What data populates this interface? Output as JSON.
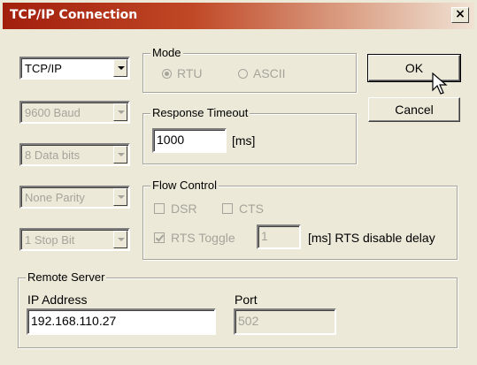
{
  "window": {
    "title": "TCP/IP Connection",
    "close_glyph": "×"
  },
  "left_column": {
    "connection_type": "TCP/IP",
    "baud": "9600 Baud",
    "data_bits": "8 Data bits",
    "parity": "None Parity",
    "stop_bits": "1 Stop Bit"
  },
  "mode": {
    "label": "Mode",
    "options": [
      {
        "label": "RTU",
        "selected": true
      },
      {
        "label": "ASCII",
        "selected": false
      }
    ]
  },
  "response_timeout": {
    "label": "Response Timeout",
    "value": "1000",
    "unit": "[ms]"
  },
  "flow_control": {
    "label": "Flow Control",
    "dsr": "DSR",
    "cts": "CTS",
    "rts_toggle": "RTS Toggle",
    "rts_value": "1",
    "rts_suffix": "[ms] RTS disable delay"
  },
  "remote_server": {
    "label": "Remote Server",
    "ip_label": "IP Address",
    "ip_value": "192.168.110.27",
    "port_label": "Port",
    "port_value": "502"
  },
  "buttons": {
    "ok": "OK",
    "cancel": "Cancel"
  }
}
